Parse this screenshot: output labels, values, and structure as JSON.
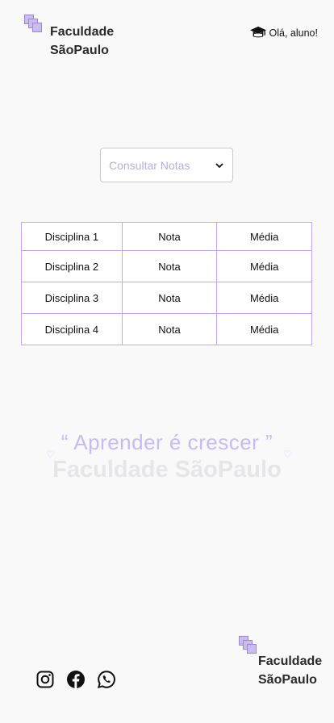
{
  "header": {
    "brand_line1": "Faculdade",
    "brand_line2": "SãoPaulo",
    "greeting": "Olá, aluno!"
  },
  "notes_select": {
    "selected": "Consultar Notas"
  },
  "grades_table": {
    "rows": [
      [
        "Disciplina 1",
        "Nota",
        "Média"
      ],
      [
        "Disciplina 2",
        "Nota",
        "Média"
      ],
      [
        "Disciplina 3",
        "Nota",
        "Média"
      ],
      [
        "Disciplina 4",
        "Nota",
        "Média"
      ]
    ]
  },
  "motto": {
    "quote": "“ Aprender é crescer ”",
    "subtitle": "Faculdade SãoPaulo"
  },
  "footer": {
    "brand_line1": "Faculdade",
    "brand_line2": "SãoPaulo",
    "social_icons": [
      "instagram-icon",
      "facebook-icon",
      "whatsapp-icon"
    ]
  },
  "colors": {
    "accent": "#b7a7e8",
    "table_border": "#c6a8e6",
    "background": "#f9f9fa"
  }
}
